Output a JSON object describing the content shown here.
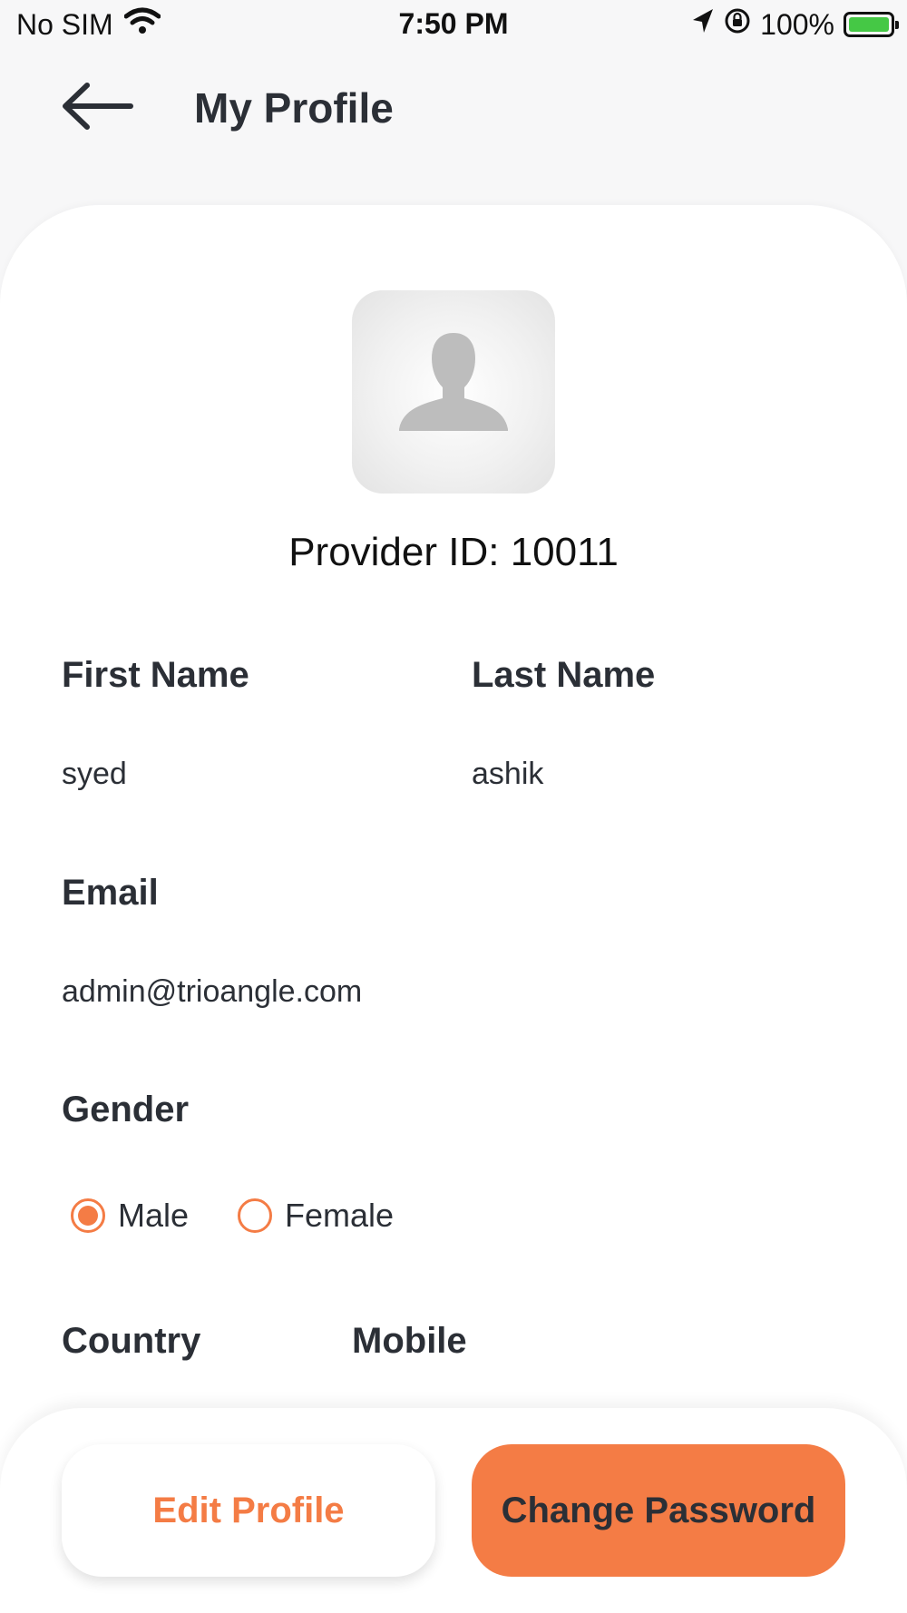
{
  "status_bar": {
    "carrier": "No SIM",
    "time": "7:50 PM",
    "battery": "100%"
  },
  "header": {
    "title": "My Profile"
  },
  "profile": {
    "provider_id": "Provider ID: 10011",
    "first_name_label": "First Name",
    "first_name_value": "syed",
    "last_name_label": "Last Name",
    "last_name_value": "ashik",
    "email_label": "Email",
    "email_value": "admin@trioangle.com",
    "gender_label": "Gender",
    "gender_options": [
      "Male",
      "Female"
    ],
    "gender_selected": "Male",
    "country_label": "Country",
    "mobile_label": "Mobile"
  },
  "actions": {
    "edit_profile": "Edit Profile",
    "change_password": "Change Password"
  },
  "colors": {
    "accent": "#f47c45",
    "text": "#2b2f36"
  }
}
